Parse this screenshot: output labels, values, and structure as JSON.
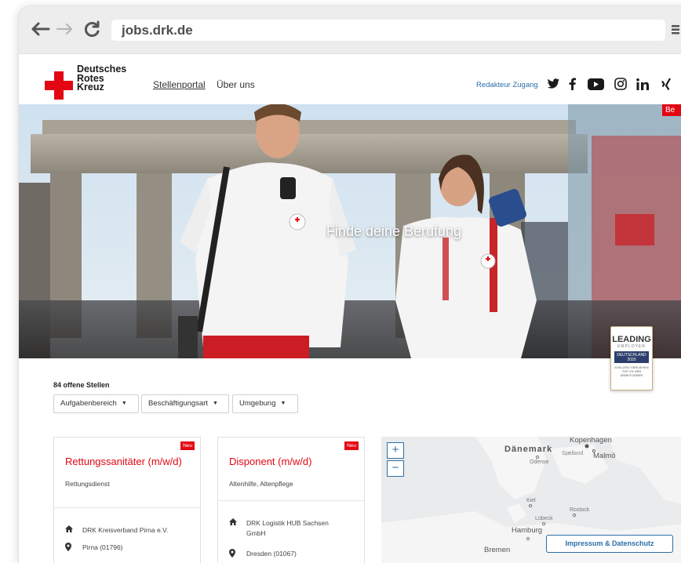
{
  "browser": {
    "url": "jobs.drk.de"
  },
  "header": {
    "logo_lines": [
      "Deutsches",
      "Rotes",
      "Kreuz"
    ],
    "nav": {
      "stellenportal": "Stellenportal",
      "ueber_uns": "Über uns"
    },
    "redakteur": "Redakteur Zugang",
    "social_icons": [
      "twitter-icon",
      "facebook-icon",
      "youtube-icon",
      "instagram-icon",
      "linkedin-icon",
      "xing-icon"
    ]
  },
  "hero": {
    "title": "Finde deine Berufung",
    "corner_badge": "Be",
    "leading_badge": {
      "line1": "LEADING",
      "line2": "EMPLOYER",
      "line3": "DEUTSCHLAND",
      "line4": "2020",
      "line5": "EXKLUSIV VERLIEHEN",
      "line6": "TOP 1% DER ARBEITGEBER"
    }
  },
  "results": {
    "count": "84 offene Stellen",
    "filters": [
      "Aufgabenbereich",
      "Beschäftigungsart",
      "Umgebung"
    ]
  },
  "cards": [
    {
      "badge": "Neu",
      "title": "Rettungssanitäter (m/w/d)",
      "category": "Rettungsdienst",
      "org": "DRK Kreisverband Pirna e.V.",
      "location": "Pirna (01796)"
    },
    {
      "badge": "Neu",
      "title": "Disponent (m/w/d)",
      "category": "Altenhilfe, Altenpflege",
      "org": "DRK Logistik HUB Sachsen GmbH",
      "location": "Dresden (01067)"
    }
  ],
  "map": {
    "zoom_in": "+",
    "zoom_out": "−",
    "labels": {
      "kopenhagen": "Kopenhagen",
      "daenemark": "Dänemark",
      "sjaelland": "Sjælland",
      "malmoe": "Malmö",
      "odense": "Odense",
      "kiel": "Kiel",
      "rostock": "Rostock",
      "luebeck": "Lübeck",
      "hamburg": "Hamburg",
      "bremen": "Bremen"
    }
  },
  "footer": {
    "impressum": "Impressum & Datenschutz"
  },
  "colors": {
    "brand_red": "#e30613",
    "link_blue": "#2b6fa8"
  }
}
